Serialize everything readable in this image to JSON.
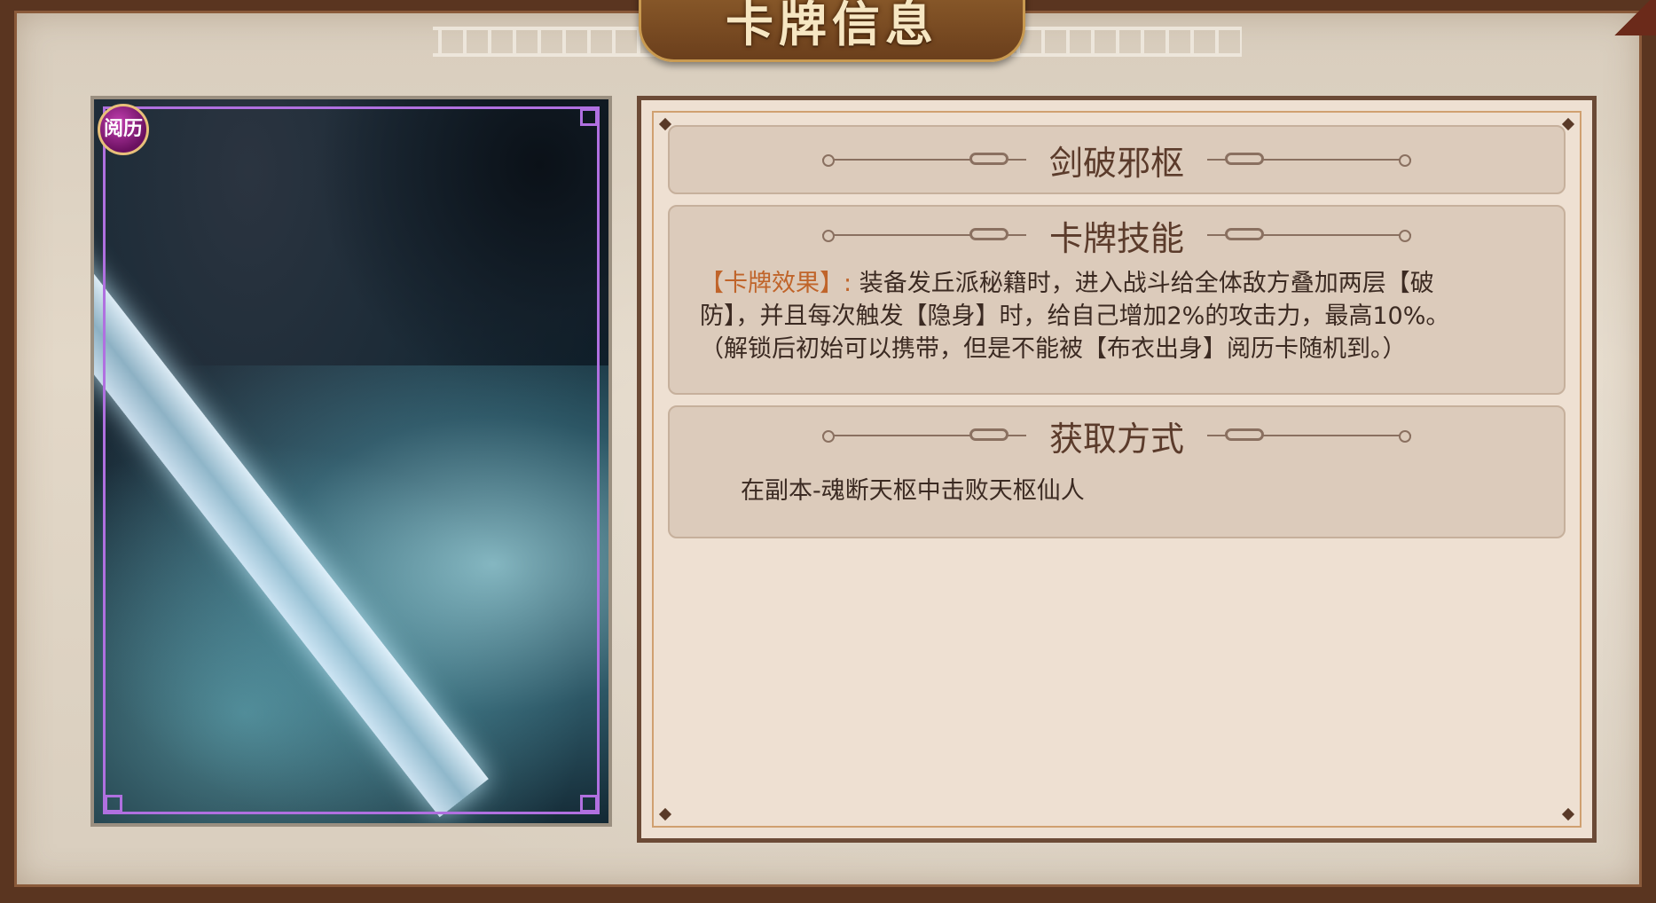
{
  "window": {
    "title": "卡牌信息"
  },
  "card": {
    "badge": "阅历",
    "name": "剑破邪枢"
  },
  "skill": {
    "header": "卡牌技能",
    "effect_tag": "【卡牌效果】",
    "effect_sep": ":",
    "effect_line1": "装备发丘派秘籍时，进入战斗给全体敌方叠加两层【破",
    "effect_line2": "防】，并且每次触发【隐身】时，给自己增加2%的攻击力，最高10%。",
    "effect_line3": "（解锁后初始可以携带，但是不能被【布衣出身】阅历卡随机到。）"
  },
  "acquire": {
    "header": "获取方式",
    "text": "在副本-魂断天枢中击败天枢仙人"
  },
  "colors": {
    "frame": "#5a3520",
    "panel": "#eee0d2",
    "section": "#dccbbb",
    "effect_tag": "#c0642a",
    "card_border": "#b070e0"
  }
}
